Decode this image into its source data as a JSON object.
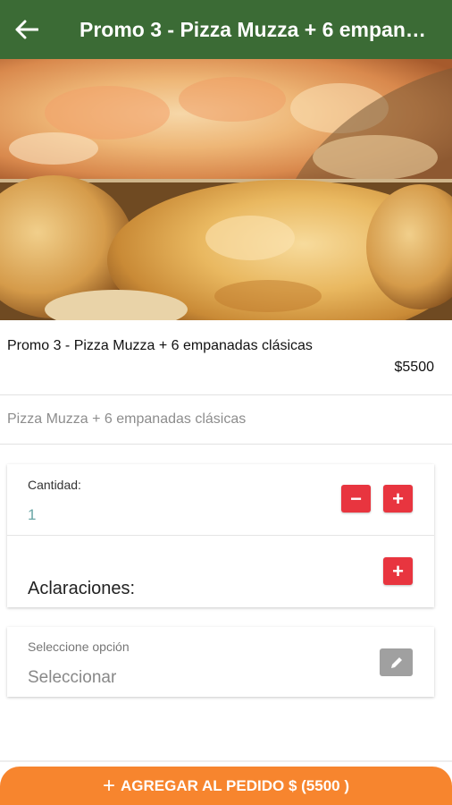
{
  "appbar": {
    "back_icon": "arrow-back-icon",
    "title": "Promo 3 - Pizza Muzza + 6 empanadas clásicas",
    "background": "#3b6b35"
  },
  "hero": {
    "image_alt": "pizza-and-empanadas-photo"
  },
  "product": {
    "name": "Promo 3 - Pizza Muzza + 6 empanadas clásicas",
    "price": "$5500",
    "description": "Pizza Muzza + 6 empanadas clásicas"
  },
  "quantity_card": {
    "label": "Cantidad:",
    "value": "1",
    "minus": "−",
    "plus": "+",
    "notes_label": "Aclaraciones:",
    "notes_plus": "+"
  },
  "option_card": {
    "label": "Seleccione opción",
    "value": "Seleccionar",
    "edit_icon": "pencil-icon"
  },
  "footer": {
    "plus": "+",
    "button_label": "AGREGAR AL PEDIDO $ (5500 )",
    "color": "#f7852e"
  },
  "colors": {
    "accent_red": "#e8353f",
    "quantity_teal": "#6aa6a6"
  }
}
